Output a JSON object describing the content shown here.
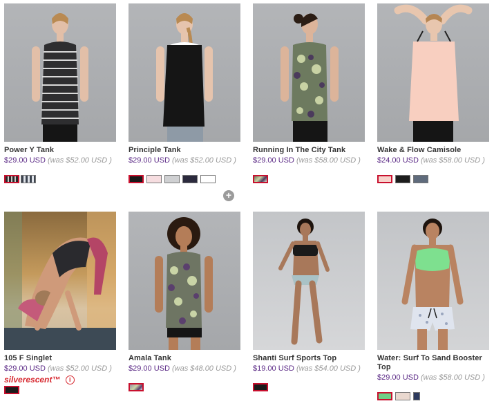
{
  "products": [
    {
      "name": "Power Y Tank",
      "price": "$29.00 USD",
      "was": "(was $52.00 USD )",
      "swatches": [
        "#2a2a2a",
        "#7c8594"
      ]
    },
    {
      "name": "Principle Tank",
      "price": "$29.00 USD",
      "was": "(was $52.00 USD )",
      "swatches": [
        "#1a1a1a",
        "#f6dde0",
        "#cfd0d2",
        "#2b2a3d",
        "#ffffff"
      ]
    },
    {
      "name": "Running In The City Tank",
      "price": "$29.00 USD",
      "was": "(was $58.00 USD )",
      "swatches": [
        "#7c7f8f"
      ]
    },
    {
      "name": "Wake & Flow Camisole",
      "price": "$24.00 USD",
      "was": "(was $58.00 USD )",
      "swatches": [
        "#f7d2cb",
        "#1d1d1d",
        "#5f6b7c"
      ]
    },
    {
      "name": "105 F Singlet",
      "price": "$29.00 USD",
      "was": "(was $52.00 USD )",
      "tag": "silverescent™",
      "swatches": [
        "#1b1b1b"
      ]
    },
    {
      "name": "Amala Tank",
      "price": "$29.00 USD",
      "was": "(was $48.00 USD )",
      "swatches": [
        "#9a8fa6"
      ]
    },
    {
      "name": "Shanti Surf Sports Top",
      "price": "$19.00 USD",
      "was": "(was $54.00 USD )",
      "swatches": [
        "#1b1b1b"
      ]
    },
    {
      "name": "Water: Surf To Sand Booster Top",
      "price": "$29.00 USD",
      "was": "(was $58.00 USD )",
      "swatches": [
        "#6fcf86",
        "#e9d8cf",
        "#2c3a5e"
      ]
    }
  ],
  "icons": {
    "more_colors": "plus-icon",
    "info": "info-icon"
  },
  "colors": {
    "price": "#5b2a86",
    "was": "#9a9a9a",
    "selected_swatch_border": "#c8102e",
    "tag": "#d6262d"
  }
}
